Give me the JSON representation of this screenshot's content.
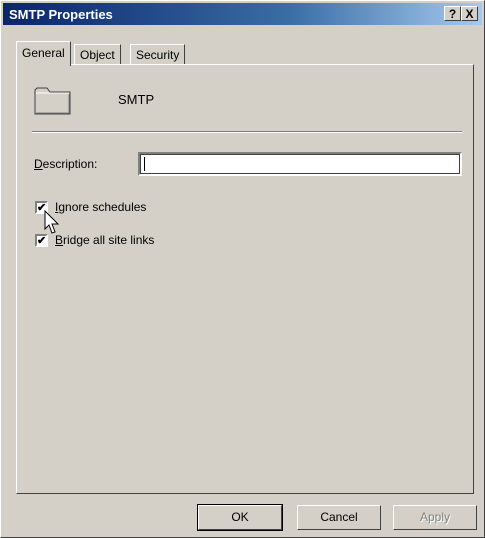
{
  "window": {
    "title": "SMTP Properties",
    "help_label": "?",
    "close_label": "X"
  },
  "tabs": [
    {
      "label": "General",
      "active": true
    },
    {
      "label": "Object",
      "active": false
    },
    {
      "label": "Security",
      "active": false
    }
  ],
  "general": {
    "object_name": "SMTP",
    "description_label_accel": "D",
    "description_label_rest": "escription:",
    "description_value": "",
    "checkboxes": [
      {
        "accel": "I",
        "rest": "gnore schedules",
        "checked": true
      },
      {
        "accel": "B",
        "rest": "ridge all site links",
        "checked": true
      }
    ]
  },
  "buttons": {
    "ok": "OK",
    "cancel": "Cancel",
    "apply": "Apply"
  },
  "colors": {
    "titlebar_start": "#0a246a",
    "titlebar_end": "#a6caf0",
    "face": "#d4d0c8"
  },
  "icons": {
    "object": "folder-icon",
    "pointer": "mouse-cursor-icon"
  }
}
